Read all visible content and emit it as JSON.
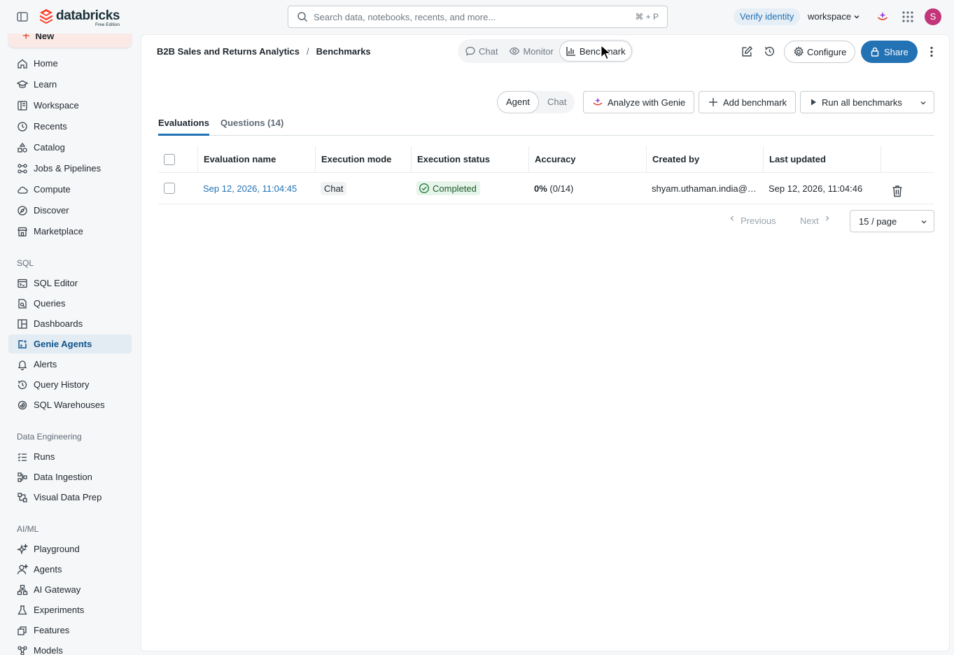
{
  "app": {
    "logo_text": "databricks",
    "logo_sub": "Free Edition",
    "brand_color": "#ff3621"
  },
  "topbar": {
    "search_placeholder": "Search data, notebooks, recents, and more...",
    "search_shortcut": "⌘ + P",
    "verify_label": "Verify identity",
    "workspace_label": "workspace",
    "avatar_initial": "S"
  },
  "sidebar": {
    "new_label": "New",
    "items_top": [
      {
        "label": "Home",
        "icon": "home-icon"
      },
      {
        "label": "Learn",
        "icon": "learn-icon"
      },
      {
        "label": "Workspace",
        "icon": "workspace-icon"
      },
      {
        "label": "Recents",
        "icon": "clock-icon"
      },
      {
        "label": "Catalog",
        "icon": "catalog-icon"
      },
      {
        "label": "Jobs & Pipelines",
        "icon": "jobs-icon"
      },
      {
        "label": "Compute",
        "icon": "cloud-icon"
      },
      {
        "label": "Discover",
        "icon": "compass-icon"
      },
      {
        "label": "Marketplace",
        "icon": "store-icon"
      }
    ],
    "sql_heading": "SQL",
    "items_sql": [
      {
        "label": "SQL Editor",
        "icon": "sql-editor-icon"
      },
      {
        "label": "Queries",
        "icon": "queries-icon"
      },
      {
        "label": "Dashboards",
        "icon": "dashboards-icon"
      },
      {
        "label": "Genie Agents",
        "icon": "genie-icon",
        "active": true
      },
      {
        "label": "Alerts",
        "icon": "bell-icon"
      },
      {
        "label": "Query History",
        "icon": "history-icon"
      },
      {
        "label": "SQL Warehouses",
        "icon": "warehouse-icon"
      }
    ],
    "de_heading": "Data Engineering",
    "items_de": [
      {
        "label": "Runs",
        "icon": "runs-icon"
      },
      {
        "label": "Data Ingestion",
        "icon": "ingestion-icon"
      },
      {
        "label": "Visual Data Prep",
        "icon": "data-prep-icon"
      }
    ],
    "ml_heading": "AI/ML",
    "items_ml": [
      {
        "label": "Playground",
        "icon": "sparkle-icon"
      },
      {
        "label": "Agents",
        "icon": "agents-icon"
      },
      {
        "label": "AI Gateway",
        "icon": "gateway-icon"
      },
      {
        "label": "Experiments",
        "icon": "flask-icon"
      },
      {
        "label": "Features",
        "icon": "features-icon"
      },
      {
        "label": "Models",
        "icon": "models-icon"
      }
    ]
  },
  "header": {
    "breadcrumb_parent": "B2B Sales and Returns Analytics",
    "breadcrumb_sep": "/",
    "breadcrumb_current": "Benchmarks",
    "mode_tabs": [
      {
        "label": "Chat"
      },
      {
        "label": "Monitor"
      },
      {
        "label": "Benchmark",
        "active": true
      }
    ],
    "configure_label": "Configure",
    "share_label": "Share"
  },
  "toolbar": {
    "segment": [
      {
        "label": "Agent",
        "active": true
      },
      {
        "label": "Chat"
      }
    ],
    "analyze_label": "Analyze with Genie",
    "add_label": "Add benchmark",
    "run_all_label": "Run all benchmarks"
  },
  "subtabs": {
    "evaluations": "Evaluations",
    "questions": "Questions (14)"
  },
  "table": {
    "columns": [
      "Evaluation name",
      "Execution mode",
      "Execution status",
      "Accuracy",
      "Created by",
      "Last updated"
    ],
    "rows": [
      {
        "name": "Sep 12, 2026, 11:04:45",
        "mode": "Chat",
        "status": "Completed",
        "accuracy_pct": "0%",
        "accuracy_frac": "(0/14)",
        "created_by": "shyam.uthaman.india@…",
        "last_updated": "Sep 12, 2026, 11:04:46"
      }
    ]
  },
  "pagination": {
    "previous": "Previous",
    "next": "Next",
    "page_size": "15 / page"
  }
}
